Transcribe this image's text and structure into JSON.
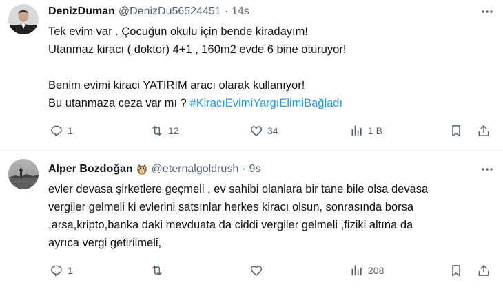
{
  "tweets": [
    {
      "author": "DenizDuman",
      "handle": "@DenizDu56524451",
      "separator": "·",
      "time": "14s",
      "lines": [
        "Tek evim var . Çocuğun okulu için bende kiradayım!",
        "Utanmaz kiracı ( doktor) 4+1 , 160m2 evde 6 bine oturuyor!",
        "",
        "Benim evimi kiraci YATIRIM aracı olarak kullanıyor!",
        "Bu utanmaza ceza var mı ? "
      ],
      "hashtag": "#KiracıEvimiYargıElimiBağladı",
      "actions": {
        "replies": "1",
        "reposts": "12",
        "likes": "34",
        "views": "1 B"
      },
      "icons": [
        "more-icon",
        "reply-icon",
        "repost-icon",
        "like-icon",
        "views-icon",
        "bookmark-icon",
        "share-icon"
      ]
    },
    {
      "author": "Alper Bozdoğan",
      "author_emoji": "owl",
      "handle": "@eternalgoldrush",
      "separator": "·",
      "time": "9s",
      "lines": [
        "evler devasa şirketlere geçmeli , ev sahibi olanlara bir tane bile olsa devasa",
        "vergiler gelmeli ki evlerini satsınlar herkes kiracı olsun, sonrasında borsa",
        ",arsa,kripto,banka daki mevduata da ciddi vergiler gelmeli ,fiziki altına da",
        "ayrıca vergi getirilmeli,"
      ],
      "actions": {
        "replies": "1",
        "reposts": "",
        "likes": "",
        "views": "208"
      },
      "icons": [
        "more-icon",
        "reply-icon",
        "repost-icon",
        "like-icon",
        "views-icon",
        "bookmark-icon",
        "share-icon"
      ]
    }
  ],
  "colors": {
    "text": "#0f1419",
    "secondary": "#536471",
    "link": "#1d9bf0",
    "divider": "#eff3f4"
  }
}
